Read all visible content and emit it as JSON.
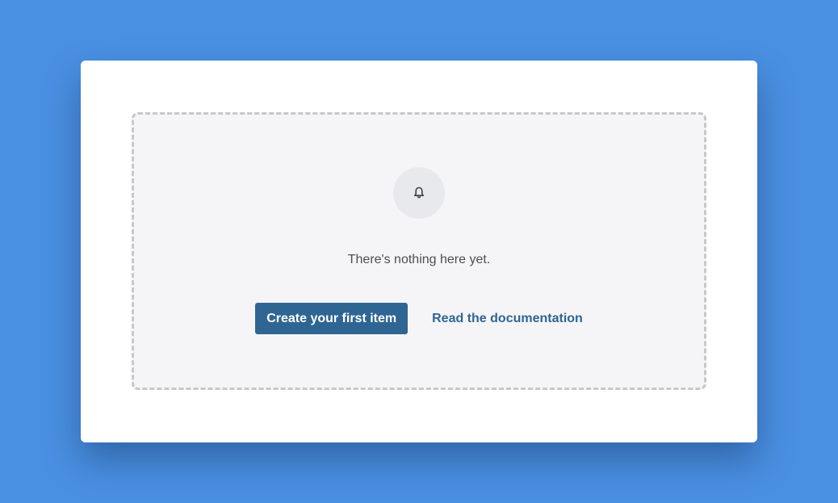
{
  "empty_state": {
    "icon": "bell-icon",
    "message": "There's nothing here yet.",
    "primary_action_label": "Create your first item",
    "secondary_action_label": "Read the documentation"
  },
  "colors": {
    "page_background": "#4a90e2",
    "primary": "#2f6593",
    "text": "#4a4f57"
  }
}
